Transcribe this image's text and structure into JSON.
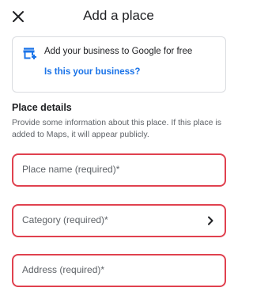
{
  "header": {
    "title": "Add a place",
    "close_icon": "close-icon"
  },
  "promo": {
    "icon": "storefront-icon",
    "text": "Add your business to Google for free",
    "link": "Is this your business?",
    "link_color": "#1a73e8"
  },
  "details": {
    "title": "Place details",
    "description": "Provide some information about this place. If this place is added to Maps, it will appear publicly."
  },
  "fields": {
    "place_name": {
      "placeholder": "Place name (required)*"
    },
    "category": {
      "placeholder": "Category (required)*",
      "icon": "chevron-right-icon"
    },
    "address": {
      "placeholder": "Address (required)*"
    }
  },
  "colors": {
    "highlight": "#e0414f",
    "text": "#202124",
    "secondary_text": "#5f6368",
    "card_border": "#dadce0"
  }
}
